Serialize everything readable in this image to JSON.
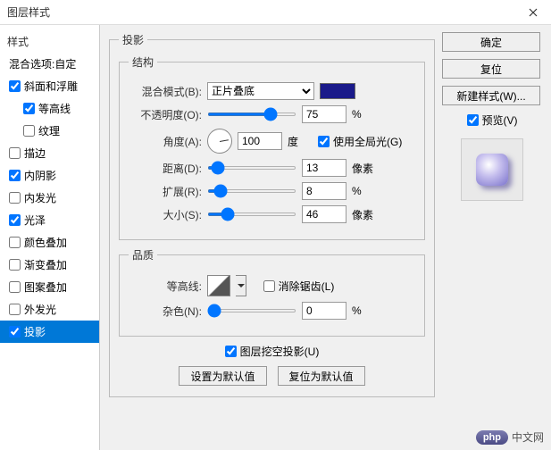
{
  "window": {
    "title": "图层样式"
  },
  "sidebar": {
    "heading": "样式",
    "blend_line": "混合选项:自定",
    "items": [
      {
        "label": "斜面和浮雕",
        "checked": true
      },
      {
        "label": "等高线",
        "checked": true,
        "indent": true
      },
      {
        "label": "纹理",
        "checked": false,
        "indent": true
      },
      {
        "label": "描边",
        "checked": false
      },
      {
        "label": "内阴影",
        "checked": true
      },
      {
        "label": "内发光",
        "checked": false
      },
      {
        "label": "光泽",
        "checked": true
      },
      {
        "label": "颜色叠加",
        "checked": false
      },
      {
        "label": "渐变叠加",
        "checked": false
      },
      {
        "label": "图案叠加",
        "checked": false
      },
      {
        "label": "外发光",
        "checked": false
      },
      {
        "label": "投影",
        "checked": true,
        "selected": true
      }
    ]
  },
  "panel": {
    "title": "投影",
    "structure": {
      "legend": "结构",
      "blend_mode_label": "混合模式(B):",
      "blend_mode_value": "正片叠底",
      "color": "#1a1a8a",
      "opacity_label": "不透明度(O):",
      "opacity_value": "75",
      "opacity_unit": "%",
      "angle_label": "角度(A):",
      "angle_value": "100",
      "angle_unit": "度",
      "global_light_label": "使用全局光(G)",
      "global_light_checked": true,
      "distance_label": "距离(D):",
      "distance_value": "13",
      "distance_unit": "像素",
      "spread_label": "扩展(R):",
      "spread_value": "8",
      "spread_unit": "%",
      "size_label": "大小(S):",
      "size_value": "46",
      "size_unit": "像素"
    },
    "quality": {
      "legend": "品质",
      "contour_label": "等高线:",
      "antialias_label": "消除锯齿(L)",
      "antialias_checked": false,
      "noise_label": "杂色(N):",
      "noise_value": "0",
      "noise_unit": "%"
    },
    "knockout_label": "图层挖空投影(U)",
    "knockout_checked": true,
    "btn_default": "设置为默认值",
    "btn_reset": "复位为默认值"
  },
  "right": {
    "ok": "确定",
    "reset": "复位",
    "newstyle": "新建样式(W)...",
    "preview_label": "预览(V)",
    "preview_checked": true
  },
  "watermark": {
    "badge": "php",
    "text": "中文网"
  }
}
